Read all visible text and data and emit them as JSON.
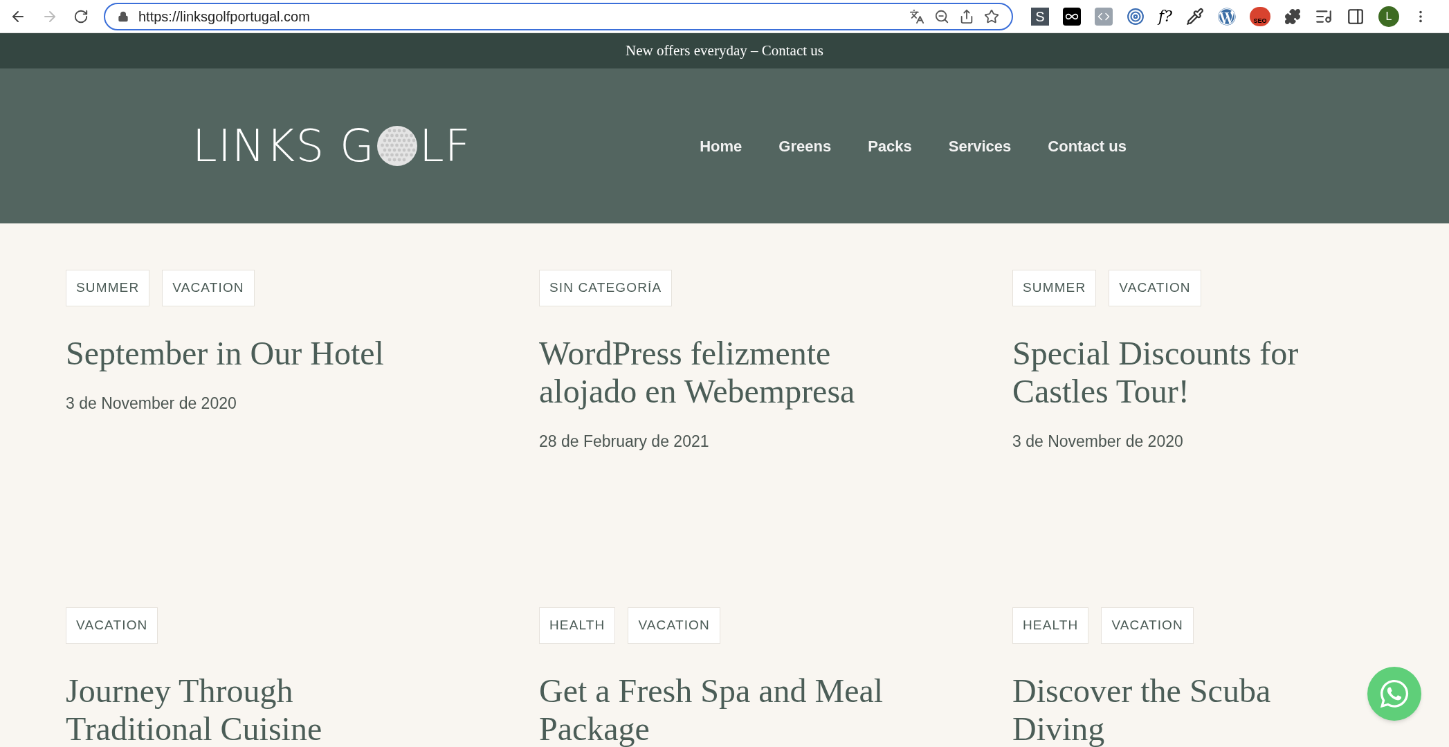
{
  "browser": {
    "url": "https://linksgolfportugal.com",
    "extensions": [
      {
        "kind": "letter",
        "label": "S"
      },
      {
        "kind": "infinity"
      },
      {
        "kind": "code"
      },
      {
        "kind": "target"
      },
      {
        "kind": "italic",
        "label": "f?"
      },
      {
        "kind": "dropper"
      },
      {
        "kind": "wordpress"
      },
      {
        "kind": "seo",
        "label": "SEO"
      },
      {
        "kind": "puzzle"
      },
      {
        "kind": "playlist"
      },
      {
        "kind": "sidepanel"
      }
    ],
    "avatar": "L"
  },
  "top_banner": "New offers everyday – Contact us",
  "header": {
    "logo": {
      "before": "LINKS G",
      "after": "LF"
    },
    "nav": [
      {
        "label": "Home"
      },
      {
        "label": "Greens"
      },
      {
        "label": "Packs"
      },
      {
        "label": "Services"
      },
      {
        "label": "Contact us"
      }
    ]
  },
  "posts": [
    {
      "tags": [
        "SUMMER",
        "VACATION"
      ],
      "title_lines": [
        "September in Our Hotel"
      ],
      "date": "3 de November de 2020"
    },
    {
      "tags": [
        "SIN CATEGORÍA"
      ],
      "title_lines": [
        "WordPress felizmente",
        "alojado en Webempresa"
      ],
      "date": "28 de February de 2021"
    },
    {
      "tags": [
        "SUMMER",
        "VACATION"
      ],
      "title_lines": [
        "Special Discounts for",
        "Castles Tour!"
      ],
      "date": "3 de November de 2020"
    },
    {
      "tags": [
        "VACATION"
      ],
      "title_lines": [
        "Journey Through",
        "Traditional Cuisine"
      ]
    },
    {
      "tags": [
        "HEALTH",
        "VACATION"
      ],
      "title_lines": [
        "Get a Fresh Spa and Meal",
        "Package"
      ]
    },
    {
      "tags": [
        "HEALTH",
        "VACATION"
      ],
      "title_lines": [
        "Discover the Scuba",
        "Diving"
      ]
    }
  ]
}
